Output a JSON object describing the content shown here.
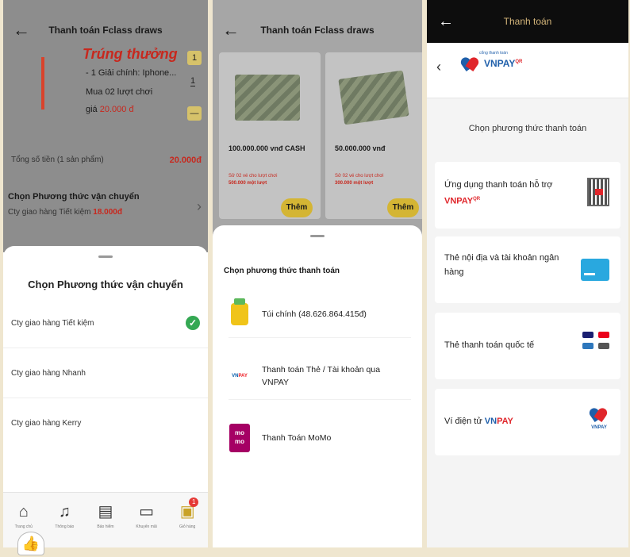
{
  "screen1": {
    "header_title": "Thanh toán Fclass draws",
    "product": {
      "title": "Trúng thưởng",
      "line1": "- 1 Giải chính: Iphone...",
      "line2": "Mua 02 lượt chơi",
      "price_prefix": "giá",
      "price": "20.000 đ",
      "qty_minus": "1",
      "qty_value": "1",
      "qty_more": "—"
    },
    "summary": {
      "label": "Tổng số tiền (1 sản phẩm)",
      "value": "20.000đ"
    },
    "shipping": {
      "title": "Chọn Phương thức vận chuyển",
      "sub_prefix": "Cty giao hàng Tiết kiệm",
      "sub_price": "18.000đ"
    },
    "sheet": {
      "title": "Chọn Phương thức vận chuyển",
      "options": [
        {
          "label": "Cty giao hàng Tiết kiệm",
          "selected": true
        },
        {
          "label": "Cty giao hàng Nhanh",
          "selected": false
        },
        {
          "label": "Cty giao hàng Kerry",
          "selected": false
        }
      ]
    },
    "tabbar": [
      {
        "label": "Trang chủ",
        "icon": "home-icon"
      },
      {
        "label": "Thông báo",
        "icon": "bell-icon"
      },
      {
        "label": "Bảo hiểm",
        "icon": "document-icon"
      },
      {
        "label": "Khuyến mãi",
        "icon": "ticket-icon"
      },
      {
        "label": "Giỏ hàng",
        "icon": "cart-icon",
        "badge": "1"
      }
    ]
  },
  "screen2": {
    "header_title": "Thanh toán Fclass draws",
    "cards": [
      {
        "title": "100.000.000 vnđ CASH",
        "sub1": "Sở 02 vé cho lượt chơi",
        "sub2": "500.000 một lượt",
        "button": "Thêm"
      },
      {
        "title": "50.000.000 vnđ",
        "sub1": "Sở 02 vé cho lượt chơi",
        "sub2": "300.000 một lượt",
        "button": "Thêm"
      }
    ],
    "sheet": {
      "title": "Chọn phương thức thanh toán",
      "options": [
        {
          "label": "Túi chính (48.626.864.415đ)",
          "icon": "wallet-icon"
        },
        {
          "label": "Thanh toán Thẻ / Tài khoản qua VNPAY",
          "icon": "vnpay-icon"
        },
        {
          "label": "Thanh Toán MoMo",
          "icon": "momo-icon",
          "icon_text": "mo mo"
        }
      ]
    }
  },
  "screen3": {
    "header_title": "Thanh toán",
    "logo_tagline": "cổng thanh toán",
    "logo_text": "VNPAY",
    "logo_sup": "QR",
    "section_label": "Chọn phương thức thanh toán",
    "methods": [
      {
        "label": "Ứng dụng thanh toán hỗ trợ",
        "brand": "VNPAY",
        "brand_sup": "QR",
        "icon": "qr-code-icon"
      },
      {
        "label": "Thẻ nội địa và tài khoản ngân hàng",
        "icon": "bank-card-icon"
      },
      {
        "label": "Thẻ thanh toán quốc tế",
        "icon": "intl-cards-icon"
      },
      {
        "label": "Ví điện tử",
        "brand": "VNPAY",
        "icon": "vnpay-wallet-icon",
        "icon_text": "VNPAY"
      }
    ]
  },
  "colors": {
    "accent_gold": "#d4b534",
    "price_red": "#c7281e",
    "success_green": "#34a853",
    "momo": "#a50064",
    "vnpay_blue": "#1f5faa",
    "vnpay_red": "#e0262b"
  }
}
